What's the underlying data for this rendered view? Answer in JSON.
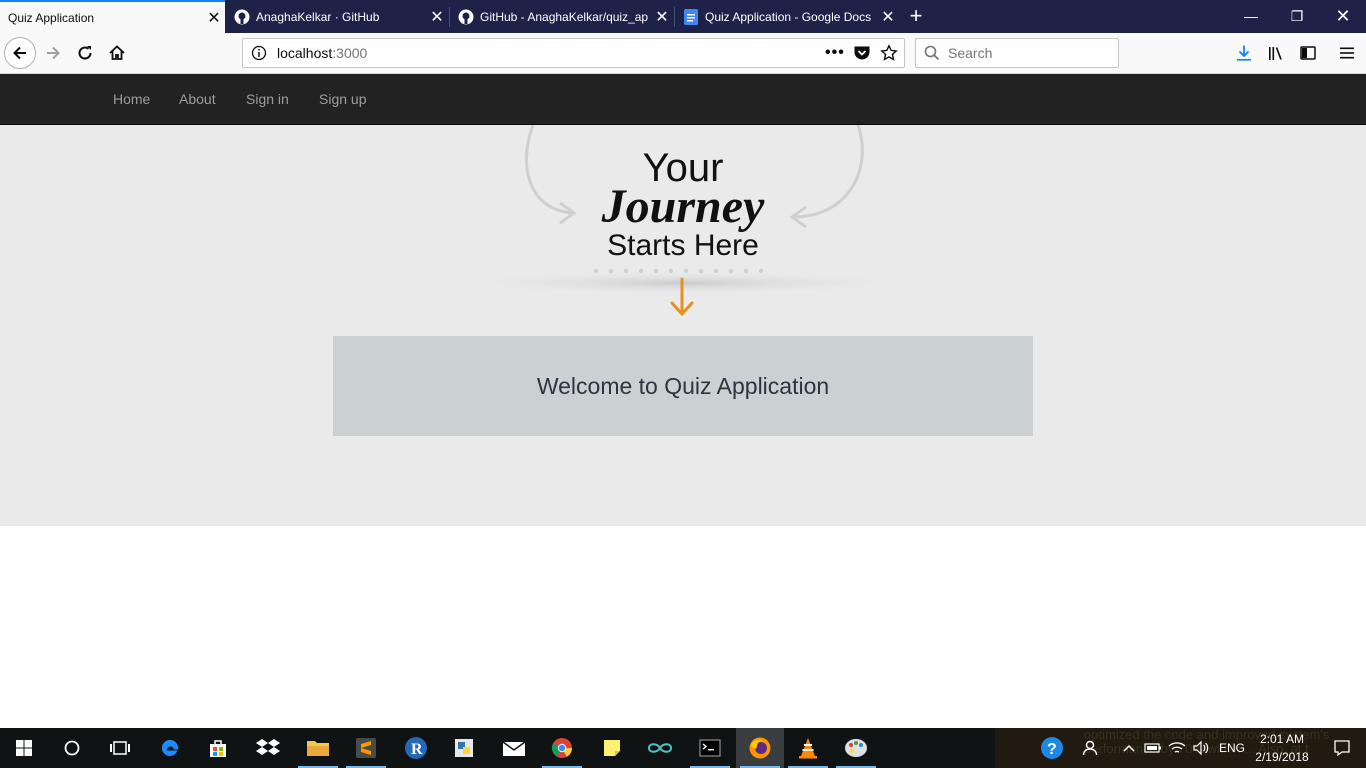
{
  "browser": {
    "tabs": [
      {
        "label": "Quiz Application",
        "active": true,
        "favicon": "none"
      },
      {
        "label": "AnaghaKelkar · GitHub",
        "active": false,
        "favicon": "github-icon"
      },
      {
        "label": "GitHub - AnaghaKelkar/quiz_ap",
        "active": false,
        "favicon": "github-icon"
      },
      {
        "label": "Quiz Application - Google Docs",
        "active": false,
        "favicon": "docs-icon"
      }
    ],
    "url_host": "localhost",
    "url_port": ":3000",
    "search_placeholder": "Search"
  },
  "site_nav": {
    "items": [
      "Home",
      "About",
      "Sign in",
      "Sign up"
    ]
  },
  "hero": {
    "line1": "Your",
    "line2": "Journey",
    "line3": "Starts Here"
  },
  "welcome": {
    "text": "Welcome to Quiz Application"
  },
  "taskbar": {
    "language": "ENG",
    "time": "2:01 AM",
    "date": "2/19/2018",
    "notification_preview": "optimized the code and improved system's performance by 70% within ... Also, at t"
  },
  "colors": {
    "titlebar": "#1e2248",
    "site_nav_bg": "#222222",
    "jumbotron_bg": "#eaeaea",
    "welcome_bg": "#cbd1d2",
    "accent_arrow": "#e8901e"
  }
}
